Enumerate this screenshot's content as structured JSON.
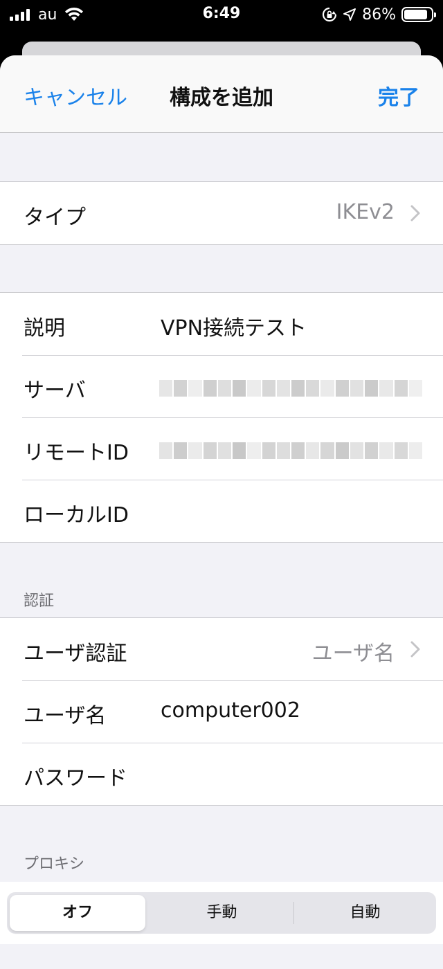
{
  "status_bar": {
    "carrier": "au",
    "time": "6:49",
    "battery_percent": "86%",
    "battery_level": 0.86,
    "icons": [
      "signal-icon",
      "wifi-icon",
      "rotation-lock-icon",
      "location-icon",
      "battery-icon"
    ]
  },
  "nav": {
    "cancel": "キャンセル",
    "title": "構成を追加",
    "done": "完了"
  },
  "type_row": {
    "label": "タイプ",
    "value": "IKEv2"
  },
  "connection": {
    "description_label": "説明",
    "description_value": "VPN接続テスト",
    "server_label": "サーバ",
    "remote_id_label": "リモートID",
    "local_id_label": "ローカルID"
  },
  "auth": {
    "header": "認証",
    "user_auth_label": "ユーザ認証",
    "user_auth_value": "ユーザ名",
    "username_label": "ユーザ名",
    "username_value": "computer002",
    "password_label": "パスワード"
  },
  "proxy": {
    "header": "プロキシ",
    "options": [
      "オフ",
      "手動",
      "自動"
    ],
    "selected": "オフ"
  },
  "colors": {
    "accent": "#1a82ea",
    "background": "#f2f2f7",
    "secondary_text": "#8e8e93"
  }
}
